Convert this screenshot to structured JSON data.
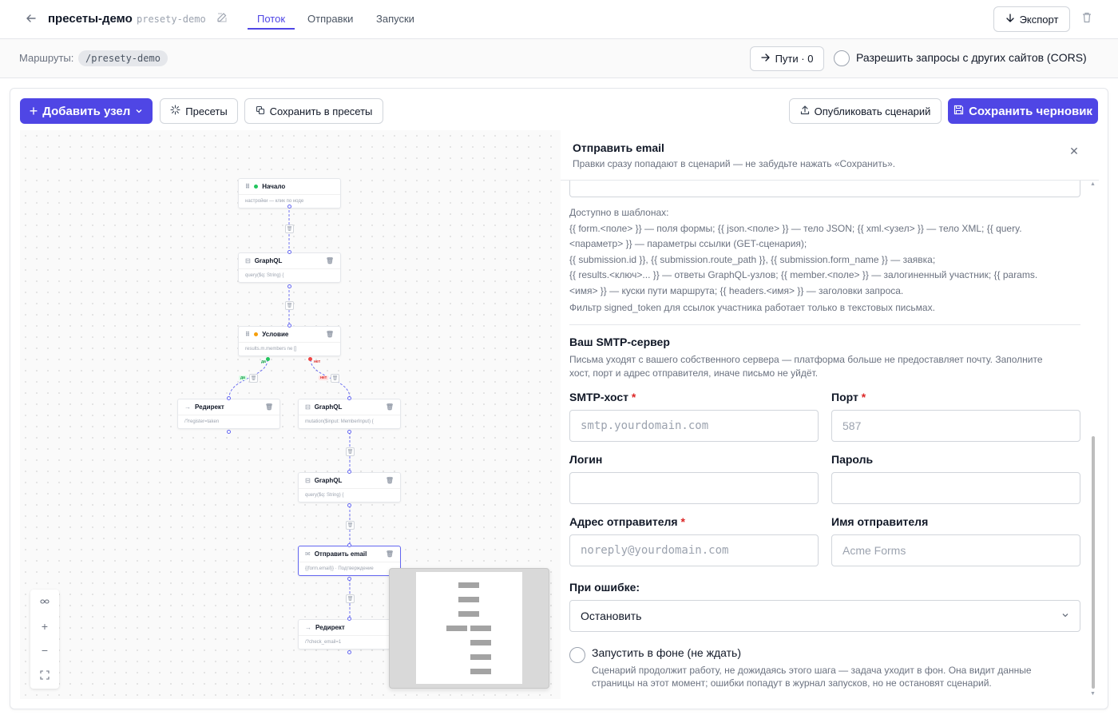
{
  "header": {
    "title": "пресеты-демо",
    "slug": "presety-demo",
    "tabs": [
      {
        "label": "Поток",
        "active": true
      },
      {
        "label": "Отправки",
        "active": false
      },
      {
        "label": "Запуски",
        "active": false
      }
    ],
    "export_label": "Экспорт"
  },
  "routes": {
    "label": "Маршруты:",
    "route": "/presety-demo",
    "paths_label": "Пути · 0",
    "cors_label": "Разрешить запросы с других сайтов (CORS)",
    "cors_enabled": false
  },
  "toolbar": {
    "add_node_label": "Добавить узел",
    "presets_label": "Пресеты",
    "save_presets_label": "Сохранить в пресеты",
    "publish_label": "Опубликовать сценарий",
    "save_draft_label": "Сохранить черновик"
  },
  "flow": {
    "nodes": [
      {
        "title": "Начало",
        "body": "настройки — клик по ноде",
        "kind": "start",
        "dot_color": "#22c55e"
      },
      {
        "title": "GraphQL",
        "body": "query($q: String) {",
        "kind": "graphql"
      },
      {
        "title": "Условие",
        "body": "results.m.members ne []",
        "kind": "condition",
        "dot_color": "#f59e0b"
      },
      {
        "title": "Редирект",
        "body": "/?register=taken",
        "kind": "redirect"
      },
      {
        "title": "GraphQL",
        "body": "mutation($input: MemberInput) {",
        "kind": "graphql"
      },
      {
        "title": "GraphQL",
        "body": "query($q: String) {",
        "kind": "graphql"
      },
      {
        "title": "Отправить email",
        "body": "{{form.email}} · Подтверждение",
        "kind": "email",
        "selected": true
      },
      {
        "title": "Редирект",
        "body": "/?check_email=1",
        "kind": "redirect"
      }
    ],
    "branch_yes": "да",
    "branch_no": "нет"
  },
  "panel": {
    "title": "Отправить email",
    "subtitle": "Правки сразу попадают в сценарий — не забудьте нажать «Сохранить».",
    "available_title": "Доступно в шаблонах:",
    "available_line1": "{{ form.<поле> }} — поля формы; {{ json.<поле> }} — тело JSON; {{ xml.<узел> }} — тело XML; {{ query.",
    "available_line2": "<параметр> }} — параметры ссылки (GET-сценария);",
    "available_line3": "{{ submission.id }}, {{ submission.route_path }}, {{ submission.form_name }} — заявка;",
    "available_line4": "{{ results.<ключ>... }} — ответы GraphQL-узлов; {{ member.<поле> }} — залогиненный участник; {{ params.",
    "available_line5": "<имя> }} — куски пути маршрута; {{ headers.<имя> }} — заголовки запроса.",
    "available_note": "Фильтр signed_token для ссылок участника работает только в текстовых письмах.",
    "smtp_title": "Ваш SMTP-сервер",
    "smtp_desc_line1": "Письма уходят с вашего собственного сервера — платформа больше не предоставляет почту. Заполните",
    "smtp_desc_line2": "хост, порт и адрес отправителя, иначе письмо не уйдёт.",
    "fields": {
      "host_label": "SMTP-хост",
      "host_placeholder": "smtp.yourdomain.com",
      "host_value": "",
      "port_label": "Порт",
      "port_placeholder": "587",
      "port_value": "",
      "login_label": "Логин",
      "login_value": "",
      "password_label": "Пароль",
      "password_value": "",
      "from_label": "Адрес отправителя",
      "from_placeholder": "noreply@yourdomain.com",
      "from_value": "",
      "from_name_label": "Имя отправителя",
      "from_name_placeholder": "Acme Forms",
      "from_name_value": ""
    },
    "on_error_label": "При ошибке:",
    "on_error_value": "Остановить",
    "background_label": "Запустить в фоне (не ждать)",
    "background_enabled": false,
    "background_desc_line1": "Сценарий продолжит работу, не дожидаясь этого шага — задача уходит в фон. Она видит данные",
    "background_desc_line2": "страницы на этот момент; ошибки попадут в журнал запусков, но не остановят сценарий."
  },
  "colors": {
    "accent": "#4f46e5",
    "required": "#dc2626",
    "yes": "#22c55e",
    "no": "#ef4444"
  }
}
